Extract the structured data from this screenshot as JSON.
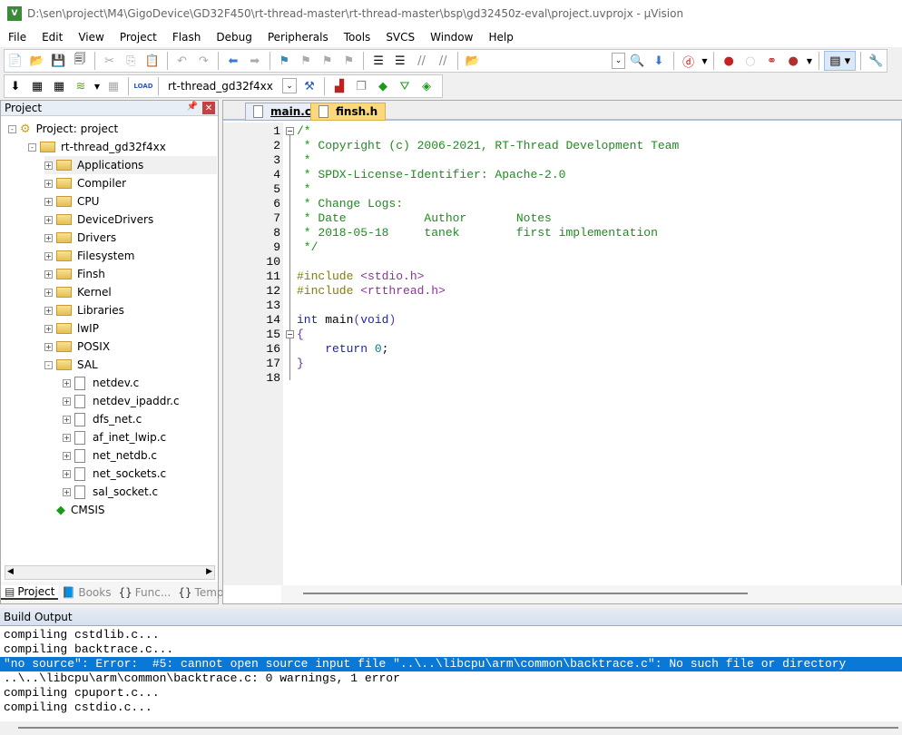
{
  "window": {
    "title": "D:\\sen\\project\\M4\\GigoDevice\\GD32F450\\rt-thread-master\\rt-thread-master\\bsp\\gd32450z-eval\\project.uvprojx - µVision",
    "icon_label": "V"
  },
  "menu": [
    "File",
    "Edit",
    "View",
    "Project",
    "Flash",
    "Debug",
    "Peripherals",
    "Tools",
    "SVCS",
    "Window",
    "Help"
  ],
  "toolbar2": {
    "target": "rt-thread_gd32f4xx"
  },
  "project_panel": {
    "title": "Project",
    "tree": [
      {
        "label": "Project: project",
        "level": 0,
        "type": "root",
        "expand": "-"
      },
      {
        "label": "rt-thread_gd32f4xx",
        "level": 1,
        "type": "target",
        "expand": "-"
      },
      {
        "label": "Applications",
        "level": 2,
        "type": "folder",
        "expand": "+",
        "selected": true
      },
      {
        "label": "Compiler",
        "level": 2,
        "type": "folder",
        "expand": "+"
      },
      {
        "label": "CPU",
        "level": 2,
        "type": "folder",
        "expand": "+"
      },
      {
        "label": "DeviceDrivers",
        "level": 2,
        "type": "folder",
        "expand": "+"
      },
      {
        "label": "Drivers",
        "level": 2,
        "type": "folder",
        "expand": "+"
      },
      {
        "label": "Filesystem",
        "level": 2,
        "type": "folder",
        "expand": "+"
      },
      {
        "label": "Finsh",
        "level": 2,
        "type": "folder",
        "expand": "+"
      },
      {
        "label": "Kernel",
        "level": 2,
        "type": "folder",
        "expand": "+"
      },
      {
        "label": "Libraries",
        "level": 2,
        "type": "folder",
        "expand": "+"
      },
      {
        "label": "lwIP",
        "level": 2,
        "type": "folder",
        "expand": "+"
      },
      {
        "label": "POSIX",
        "level": 2,
        "type": "folder",
        "expand": "+"
      },
      {
        "label": "SAL",
        "level": 2,
        "type": "folder-open",
        "expand": "-"
      },
      {
        "label": "netdev.c",
        "level": 3,
        "type": "file",
        "expand": "+"
      },
      {
        "label": "netdev_ipaddr.c",
        "level": 3,
        "type": "file",
        "expand": "+"
      },
      {
        "label": "dfs_net.c",
        "level": 3,
        "type": "file",
        "expand": "+"
      },
      {
        "label": "af_inet_lwip.c",
        "level": 3,
        "type": "file",
        "expand": "+"
      },
      {
        "label": "net_netdb.c",
        "level": 3,
        "type": "file",
        "expand": "+"
      },
      {
        "label": "net_sockets.c",
        "level": 3,
        "type": "file",
        "expand": "+"
      },
      {
        "label": "sal_socket.c",
        "level": 3,
        "type": "file",
        "expand": "+"
      },
      {
        "label": "CMSIS",
        "level": 2,
        "type": "component",
        "expand": ""
      }
    ],
    "tabs": [
      {
        "label": "Project",
        "active": true
      },
      {
        "label": "Books"
      },
      {
        "label": "Func..."
      },
      {
        "label": "Temp..."
      }
    ]
  },
  "editor": {
    "tabs": [
      {
        "label": "main.c",
        "active": true
      },
      {
        "label": "finsh.h"
      }
    ],
    "lines": [
      [
        [
          "/*",
          "c-comment"
        ]
      ],
      [
        [
          " * Copyright (c) 2006-2021, RT-Thread Development Team",
          "c-comment"
        ]
      ],
      [
        [
          " *",
          "c-comment"
        ]
      ],
      [
        [
          " * SPDX-License-Identifier: Apache-2.0",
          "c-comment"
        ]
      ],
      [
        [
          " *",
          "c-comment"
        ]
      ],
      [
        [
          " * Change Logs:",
          "c-comment"
        ]
      ],
      [
        [
          " * Date           Author       Notes",
          "c-comment"
        ]
      ],
      [
        [
          " * 2018-05-18     tanek        first implementation",
          "c-comment"
        ]
      ],
      [
        [
          " */",
          "c-comment"
        ]
      ],
      [],
      [
        [
          "#include ",
          "c-pre"
        ],
        [
          "<stdio.h>",
          "c-inc"
        ]
      ],
      [
        [
          "#include ",
          "c-pre"
        ],
        [
          "<rtthread.h>",
          "c-inc"
        ]
      ],
      [],
      [
        [
          "int",
          "c-kw"
        ],
        [
          " main",
          ""
        ],
        [
          "(",
          "c-punc"
        ],
        [
          "void",
          "c-kw"
        ],
        [
          ")",
          "c-punc"
        ]
      ],
      [
        [
          "{",
          "c-punc"
        ]
      ],
      [
        [
          "    ",
          ""
        ],
        [
          "return",
          "c-kw"
        ],
        [
          " ",
          ""
        ],
        [
          "0",
          "c-num"
        ],
        [
          ";",
          ""
        ]
      ],
      [
        [
          "}",
          "c-punc"
        ]
      ],
      []
    ]
  },
  "build_output": {
    "title": "Build Output",
    "lines": [
      "compiling cstdlib.c...",
      "compiling backtrace.c...",
      "\"no source\": Error:  #5: cannot open source input file \"..\\..\\libcpu\\arm\\common\\backtrace.c\": No such file or directory",
      "..\\..\\libcpu\\arm\\common\\backtrace.c: 0 warnings, 1 error",
      "compiling cpuport.c...",
      "compiling cstdio.c..."
    ],
    "selected_line": 2
  },
  "colors": {
    "selection": "#0a78d7",
    "comment": "#1e8c1e",
    "keyword": "#2020c0"
  }
}
